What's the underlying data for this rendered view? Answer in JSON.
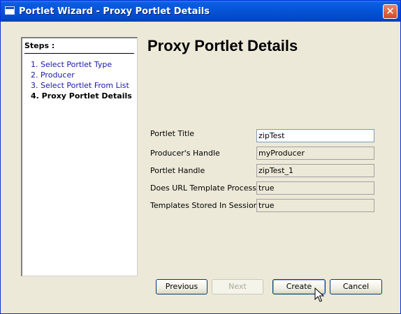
{
  "window": {
    "title": "Portlet Wizard - Proxy Portlet Details",
    "close_glyph": "✕"
  },
  "steps": {
    "header": "Steps :",
    "items": [
      {
        "label": "1. Select Portlet Type"
      },
      {
        "label": "2. Producer"
      },
      {
        "label": "3. Select Portlet From List"
      },
      {
        "label": "4. Proxy Portlet Details"
      }
    ]
  },
  "page": {
    "title": "Proxy Portlet Details"
  },
  "form": {
    "fields": [
      {
        "label": "Portlet Title",
        "value": "zipTest"
      },
      {
        "label": "Producer's Handle",
        "value": "myProducer"
      },
      {
        "label": "Portlet Handle",
        "value": "zipTest_1"
      },
      {
        "label": "Does URL Template Processing",
        "value": "true"
      },
      {
        "label": "Templates Stored In Session",
        "value": "true"
      }
    ]
  },
  "buttons": {
    "previous": "Previous",
    "next": "Next",
    "create": "Create",
    "cancel": "Cancel"
  },
  "colors": {
    "titlebar": "#0553d6",
    "step_link": "#1818a8",
    "dialog_bg": "#ece9d8"
  }
}
